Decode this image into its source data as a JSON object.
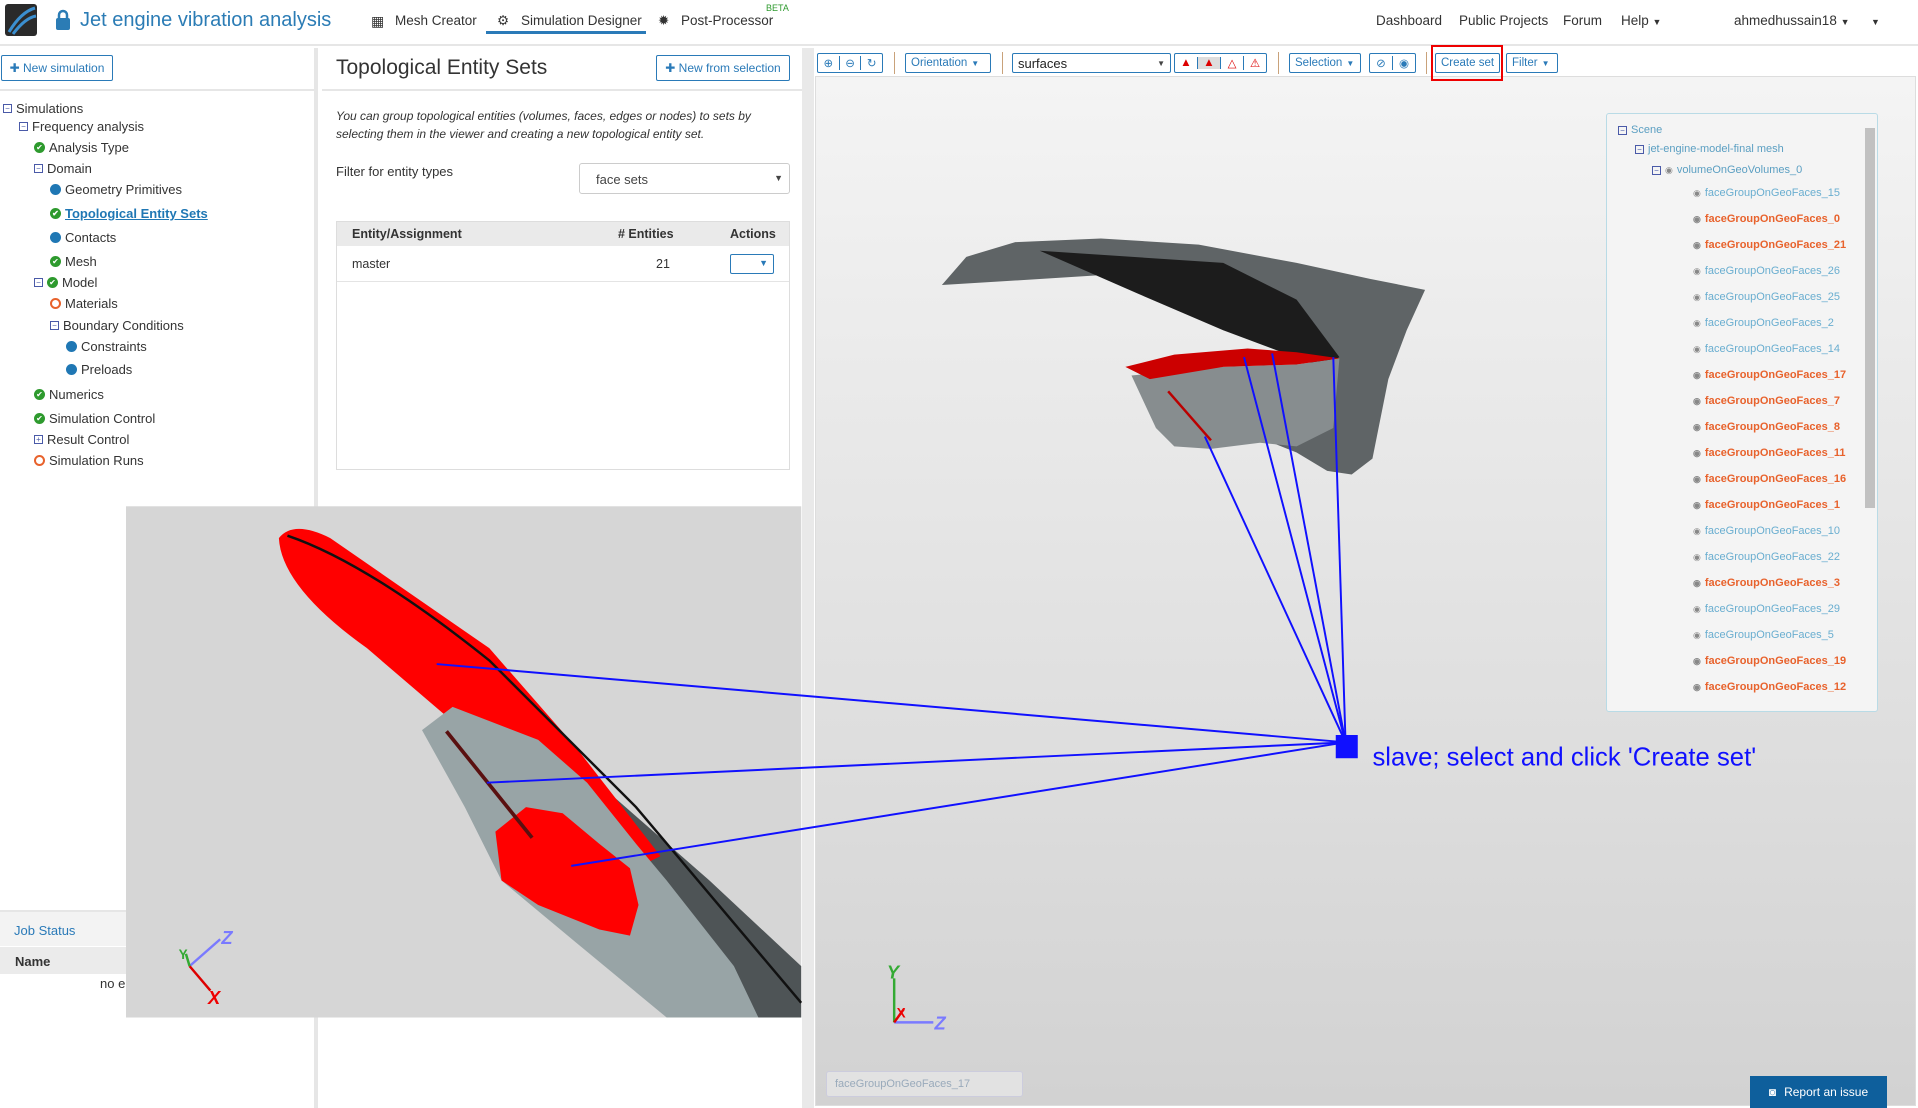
{
  "header": {
    "project_title": "Jet engine vibration analysis",
    "nav": [
      "Mesh Creator",
      "Simulation Designer",
      "Post-Processor"
    ],
    "beta": "BETA",
    "right_nav": [
      "Dashboard",
      "Public Projects",
      "Forum",
      "Help"
    ],
    "user": "ahmedhussain18"
  },
  "left": {
    "new_simulation": "New simulation",
    "tree": [
      "Simulations",
      "Frequency analysis",
      "Analysis Type",
      "Domain",
      "Geometry Primitives",
      "Topological Entity Sets",
      "Contacts",
      "Mesh",
      "Model",
      "Materials",
      "Boundary Conditions",
      "Constraints",
      "Preloads",
      "Numerics",
      "Simulation Control",
      "Result Control",
      "Simulation Runs"
    ],
    "job_status": "Job Status",
    "job_col": "Name",
    "job_empty": "no e"
  },
  "middle": {
    "title": "Topological Entity Sets",
    "new_from_selection": "New from selection",
    "description": "You can group topological entities (volumes, faces, edges or nodes) to sets by selecting them in the viewer and creating a new topological entity set.",
    "filter_label": "Filter for entity types",
    "filter_value": "face sets",
    "table": {
      "headers": [
        "Entity/Assignment",
        "# Entities",
        "Actions"
      ],
      "rows": [
        {
          "name": "master",
          "count": "21"
        }
      ]
    }
  },
  "toolbar": {
    "orientation": "Orientation",
    "render_mode": "surfaces",
    "selection": "Selection",
    "create_set": "Create set",
    "filter": "Filter"
  },
  "scene": {
    "root": "Scene",
    "mesh": "jet-engine-model-final mesh",
    "volume": "volumeOnGeoVolumes_0",
    "faces": [
      {
        "n": "faceGroupOnGeoFaces_15",
        "sel": false
      },
      {
        "n": "faceGroupOnGeoFaces_0",
        "sel": true
      },
      {
        "n": "faceGroupOnGeoFaces_21",
        "sel": true
      },
      {
        "n": "faceGroupOnGeoFaces_26",
        "sel": false
      },
      {
        "n": "faceGroupOnGeoFaces_25",
        "sel": false
      },
      {
        "n": "faceGroupOnGeoFaces_2",
        "sel": false
      },
      {
        "n": "faceGroupOnGeoFaces_14",
        "sel": false
      },
      {
        "n": "faceGroupOnGeoFaces_17",
        "sel": true
      },
      {
        "n": "faceGroupOnGeoFaces_7",
        "sel": true
      },
      {
        "n": "faceGroupOnGeoFaces_8",
        "sel": true
      },
      {
        "n": "faceGroupOnGeoFaces_11",
        "sel": true
      },
      {
        "n": "faceGroupOnGeoFaces_16",
        "sel": true
      },
      {
        "n": "faceGroupOnGeoFaces_1",
        "sel": true
      },
      {
        "n": "faceGroupOnGeoFaces_10",
        "sel": false
      },
      {
        "n": "faceGroupOnGeoFaces_22",
        "sel": false
      },
      {
        "n": "faceGroupOnGeoFaces_3",
        "sel": true
      },
      {
        "n": "faceGroupOnGeoFaces_29",
        "sel": false
      },
      {
        "n": "faceGroupOnGeoFaces_5",
        "sel": false
      },
      {
        "n": "faceGroupOnGeoFaces_19",
        "sel": true
      },
      {
        "n": "faceGroupOnGeoFaces_12",
        "sel": true
      }
    ]
  },
  "viewer": {
    "hover_label": "faceGroupOnGeoFaces_17",
    "annotation": "slave; select and click 'Create set'",
    "axes": [
      "X",
      "Y",
      "Z"
    ],
    "report_issue": "Report an issue"
  },
  "colors": {
    "accent": "#2a7ab8",
    "selected_face": "#e8622c",
    "annotation": "#1010ff"
  }
}
